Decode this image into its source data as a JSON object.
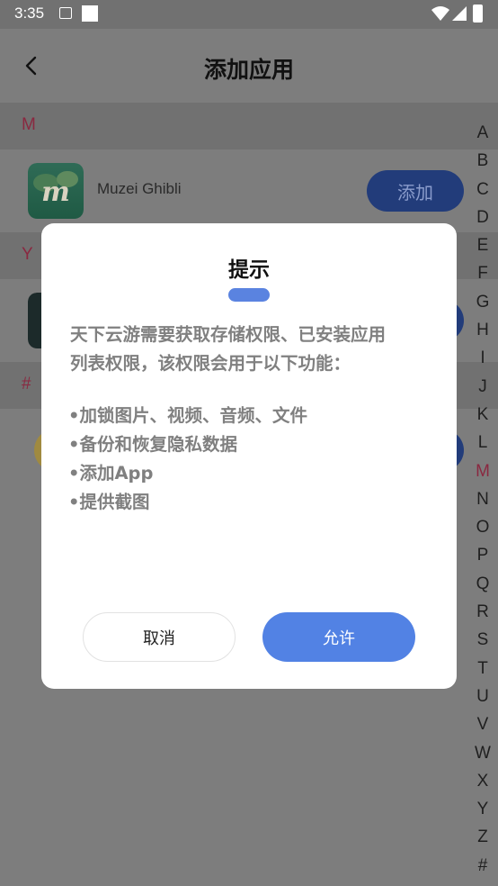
{
  "status_bar": {
    "time": "3:35"
  },
  "header": {
    "title": "添加应用"
  },
  "sections": [
    {
      "letter": "M"
    },
    {
      "letter": "Y"
    },
    {
      "letter": "#"
    }
  ],
  "apps": [
    {
      "name": "Muzei Ghibli",
      "add_label": "添加"
    }
  ],
  "alphabet": [
    "A",
    "B",
    "C",
    "D",
    "E",
    "F",
    "G",
    "H",
    "I",
    "J",
    "K",
    "L",
    "M",
    "N",
    "O",
    "P",
    "Q",
    "R",
    "S",
    "T",
    "U",
    "V",
    "W",
    "X",
    "Y",
    "Z",
    "#"
  ],
  "alphabet_active": "M",
  "dialog": {
    "title": "提示",
    "description_line1": "天下云游需要获取存储权限、已安装应用",
    "description_line2": "列表权限，该权限会用于以下功能：",
    "features": [
      "•加锁图片、视频、音频、文件",
      "•备份和恢复隐私数据",
      "•添加App",
      "•提供截图"
    ],
    "cancel_label": "取消",
    "allow_label": "允许"
  },
  "colors": {
    "accent": "#5282e4",
    "section_letter": "#8a2840",
    "scrim": "#7d7d7d"
  }
}
